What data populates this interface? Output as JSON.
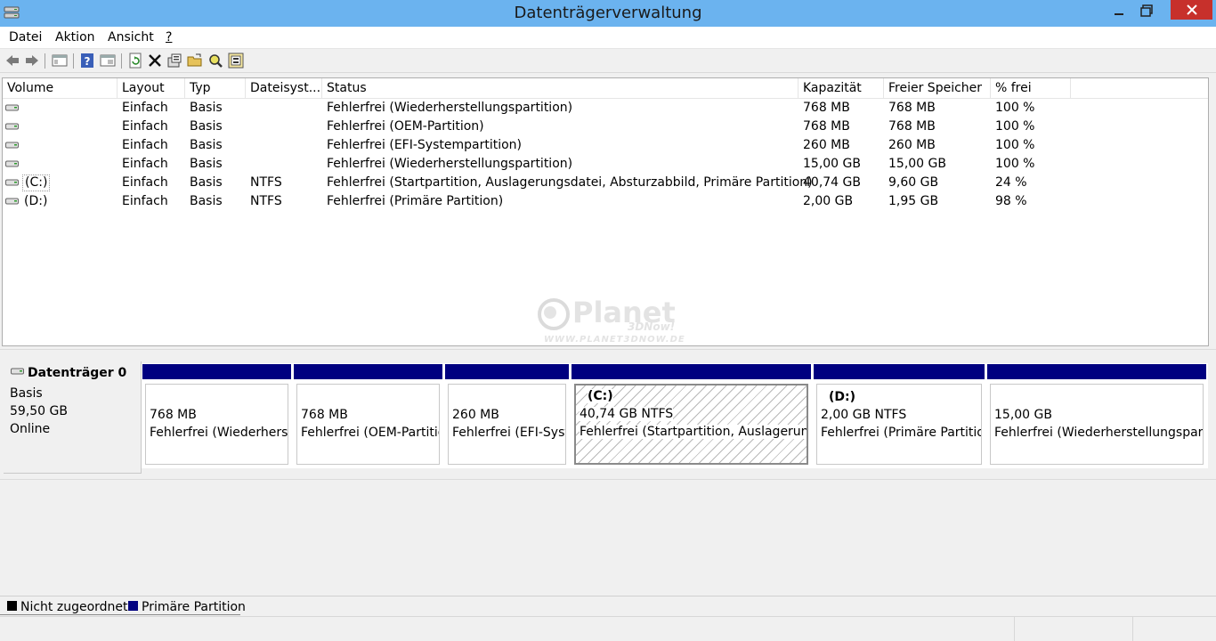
{
  "window": {
    "title": "Datenträgerverwaltung"
  },
  "menu": [
    "Datei",
    "Aktion",
    "Ansicht",
    "?"
  ],
  "toolbar": {
    "icons": [
      "back-icon",
      "forward-icon",
      "console-tree-icon",
      "help-icon",
      "properties-view-icon",
      "refresh-icon",
      "delete-icon",
      "properties-icon",
      "open-icon",
      "search-icon",
      "export-icon"
    ]
  },
  "volumes": {
    "columns": [
      "Volume",
      "Layout",
      "Typ",
      "Dateisyst...",
      "Status",
      "Kapazität",
      "Freier Speicher",
      "% frei"
    ],
    "rows": [
      {
        "volume": "",
        "layout": "Einfach",
        "typ": "Basis",
        "fs": "",
        "status": "Fehlerfrei (Wiederherstellungspartition)",
        "kap": "768 MB",
        "frei": "768 MB",
        "pct": "100 %"
      },
      {
        "volume": "",
        "layout": "Einfach",
        "typ": "Basis",
        "fs": "",
        "status": "Fehlerfrei (OEM-Partition)",
        "kap": "768 MB",
        "frei": "768 MB",
        "pct": "100 %"
      },
      {
        "volume": "",
        "layout": "Einfach",
        "typ": "Basis",
        "fs": "",
        "status": "Fehlerfrei (EFI-Systempartition)",
        "kap": "260 MB",
        "frei": "260 MB",
        "pct": "100 %"
      },
      {
        "volume": "",
        "layout": "Einfach",
        "typ": "Basis",
        "fs": "",
        "status": "Fehlerfrei (Wiederherstellungspartition)",
        "kap": "15,00 GB",
        "frei": "15,00 GB",
        "pct": "100 %"
      },
      {
        "volume": "(C:)",
        "layout": "Einfach",
        "typ": "Basis",
        "fs": "NTFS",
        "status": "Fehlerfrei (Startpartition, Auslagerungsdatei, Absturzabbild, Primäre Partition)",
        "kap": "40,74 GB",
        "frei": "9,60 GB",
        "pct": "24 %"
      },
      {
        "volume": "(D:)",
        "layout": "Einfach",
        "typ": "Basis",
        "fs": "NTFS",
        "status": "Fehlerfrei (Primäre Partition)",
        "kap": "2,00 GB",
        "frei": "1,95 GB",
        "pct": "98 %"
      }
    ]
  },
  "disk": {
    "name": "Datenträger 0",
    "type": "Basis",
    "size": "59,50 GB",
    "state": "Online",
    "partitions": [
      {
        "label": "",
        "size": "768 MB",
        "status": "Fehlerfrei (Wiederherstellungspartition)"
      },
      {
        "label": "",
        "size": "768 MB",
        "status": "Fehlerfrei (OEM-Partition)"
      },
      {
        "label": "",
        "size": "260 MB",
        "status": "Fehlerfrei (EFI-Systempartition)"
      },
      {
        "label": "(C:)",
        "size": "40,74 GB NTFS",
        "status": "Fehlerfrei (Startpartition, Auslagerungsdatei, Absturzabbild, Primäre Partition)"
      },
      {
        "label": "(D:)",
        "size": "2,00 GB NTFS",
        "status": "Fehlerfrei (Primäre Partition)"
      },
      {
        "label": "",
        "size": "15,00 GB",
        "status": "Fehlerfrei (Wiederherstellungspartition)"
      }
    ]
  },
  "legend": {
    "unallocated": "Nicht zugeordnet",
    "primary": "Primäre Partition",
    "unallocated_color": "#000000",
    "primary_color": "#000080"
  },
  "watermark": {
    "text": "Planet",
    "brand": "3DNow!",
    "url": "WWW.PLANET3DNOW.DE"
  },
  "colors": {
    "titlebar": "#6bb3ef",
    "close": "#c7302b",
    "partition_bar": "#000080"
  }
}
